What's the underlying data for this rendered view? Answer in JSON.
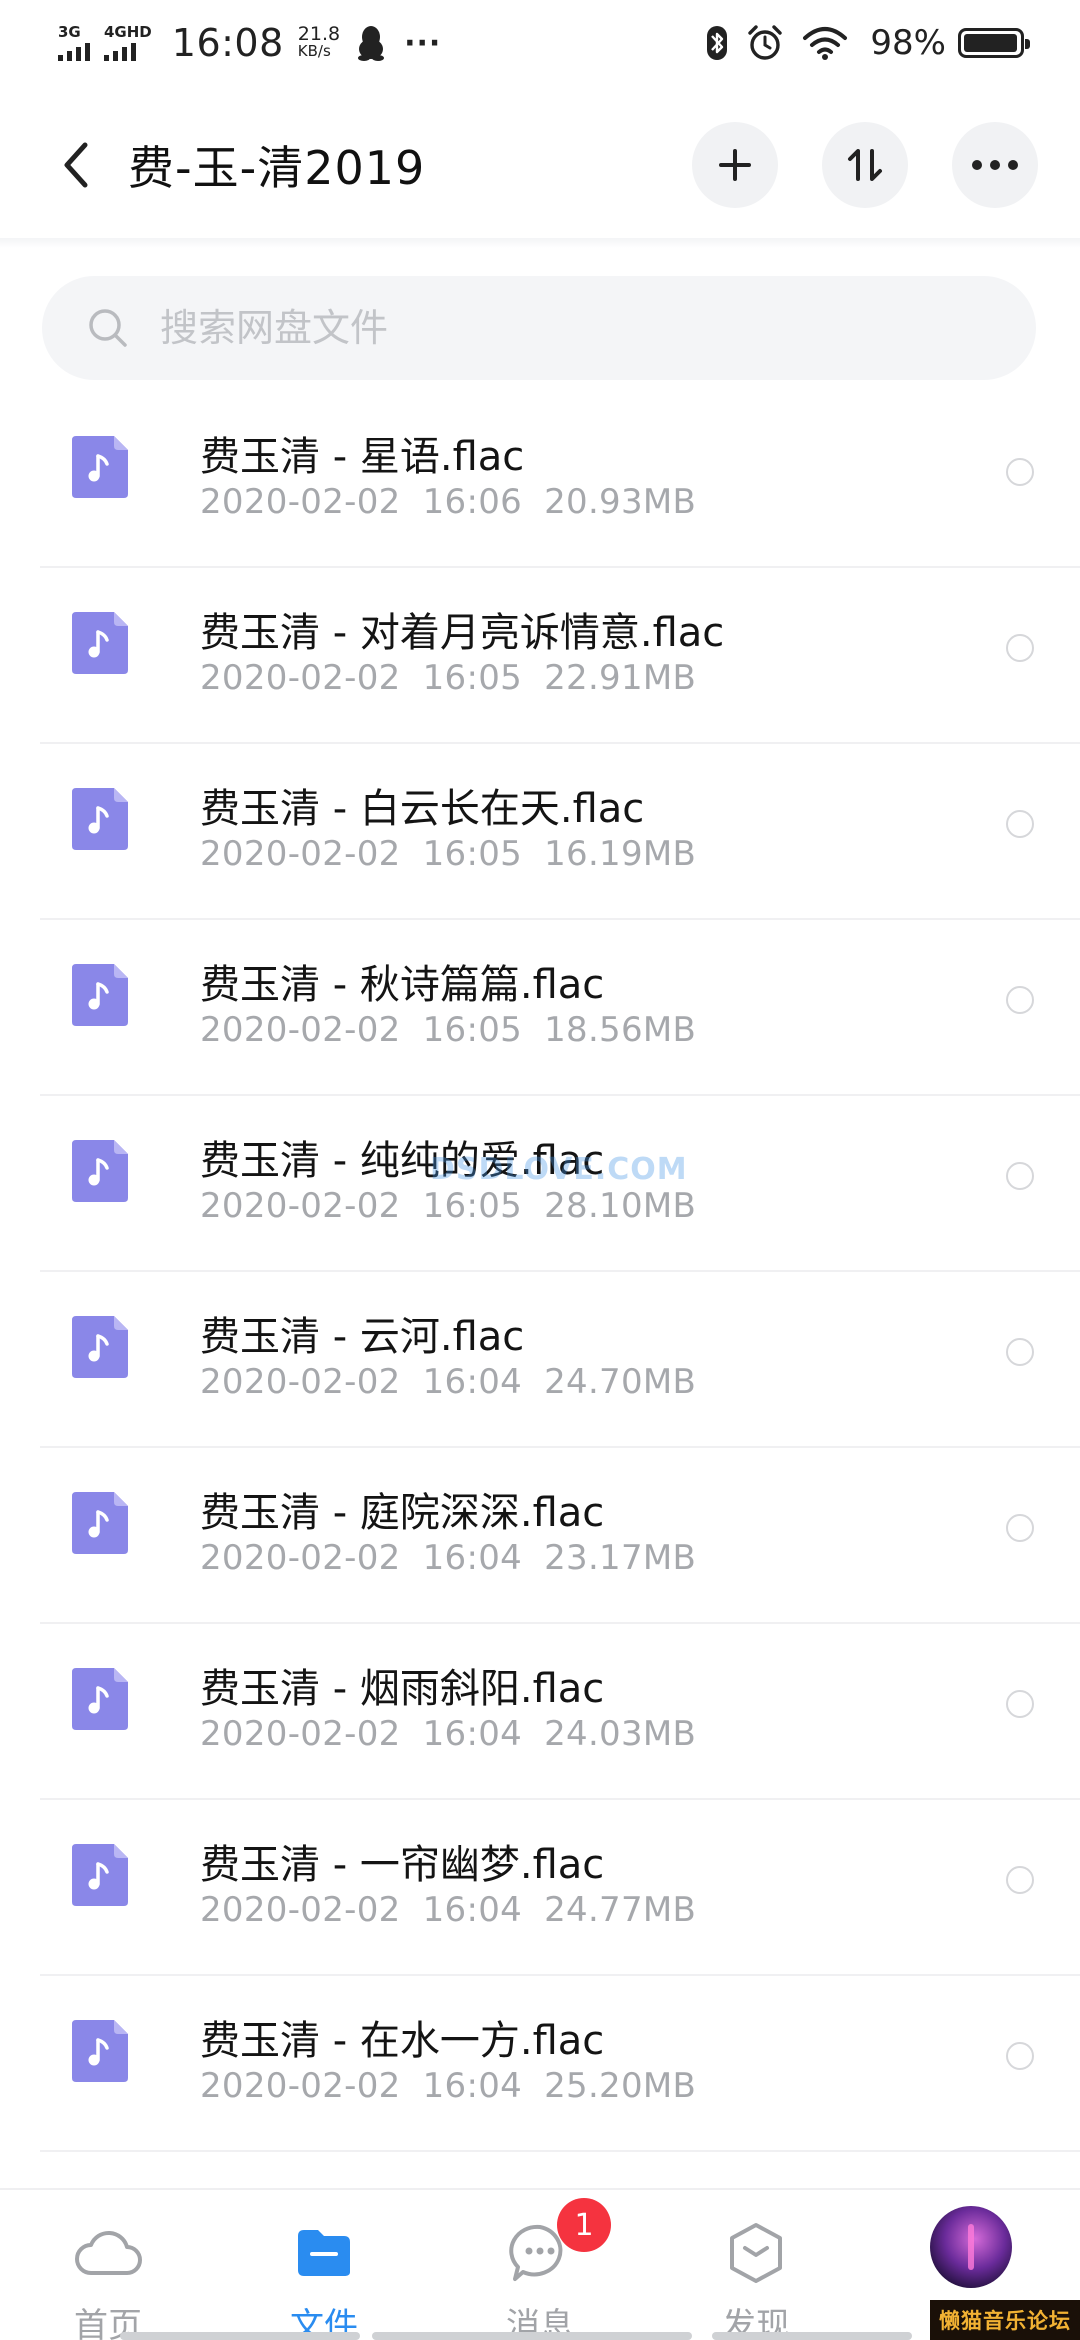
{
  "status_bar": {
    "net1": "3G",
    "net2": "4GHD",
    "time": "16:08",
    "speed_value": "21.8",
    "speed_unit": "KB/s",
    "more": "···",
    "battery_pct": "98%",
    "battery_level": 0.98
  },
  "header": {
    "title": "费-玉-清2019"
  },
  "search": {
    "placeholder": "搜索网盘文件"
  },
  "files": [
    {
      "name": "费玉清 - 星语.flac",
      "date": "2020-02-02",
      "time": "16:06",
      "size": "20.93MB"
    },
    {
      "name": "费玉清 - 对着月亮诉情意.flac",
      "date": "2020-02-02",
      "time": "16:05",
      "size": "22.91MB"
    },
    {
      "name": "费玉清 - 白云长在天.flac",
      "date": "2020-02-02",
      "time": "16:05",
      "size": "16.19MB"
    },
    {
      "name": "费玉清 - 秋诗篇篇.flac",
      "date": "2020-02-02",
      "time": "16:05",
      "size": "18.56MB"
    },
    {
      "name": "费玉清 - 纯纯的爱.flac",
      "date": "2020-02-02",
      "time": "16:05",
      "size": "28.10MB"
    },
    {
      "name": "费玉清 - 云河.flac",
      "date": "2020-02-02",
      "time": "16:04",
      "size": "24.70MB"
    },
    {
      "name": "费玉清 - 庭院深深.flac",
      "date": "2020-02-02",
      "time": "16:04",
      "size": "23.17MB"
    },
    {
      "name": "费玉清 - 烟雨斜阳.flac",
      "date": "2020-02-02",
      "time": "16:04",
      "size": "24.03MB"
    },
    {
      "name": "费玉清 - 一帘幽梦.flac",
      "date": "2020-02-02",
      "time": "16:04",
      "size": "24.77MB"
    },
    {
      "name": "费玉清 - 在水一方.flac",
      "date": "2020-02-02",
      "time": "16:04",
      "size": "25.20MB"
    }
  ],
  "watermark": "DSDLOVE.COM",
  "bottom_nav": {
    "home": "首页",
    "files": "文件",
    "messages": "消息",
    "messages_badge": "1",
    "discover": "发现"
  },
  "corner_logo": "懒猫音乐论坛",
  "colors": {
    "accent": "#2a8cf0",
    "file_icon": "#8a87e8",
    "badge": "#f5333f"
  }
}
